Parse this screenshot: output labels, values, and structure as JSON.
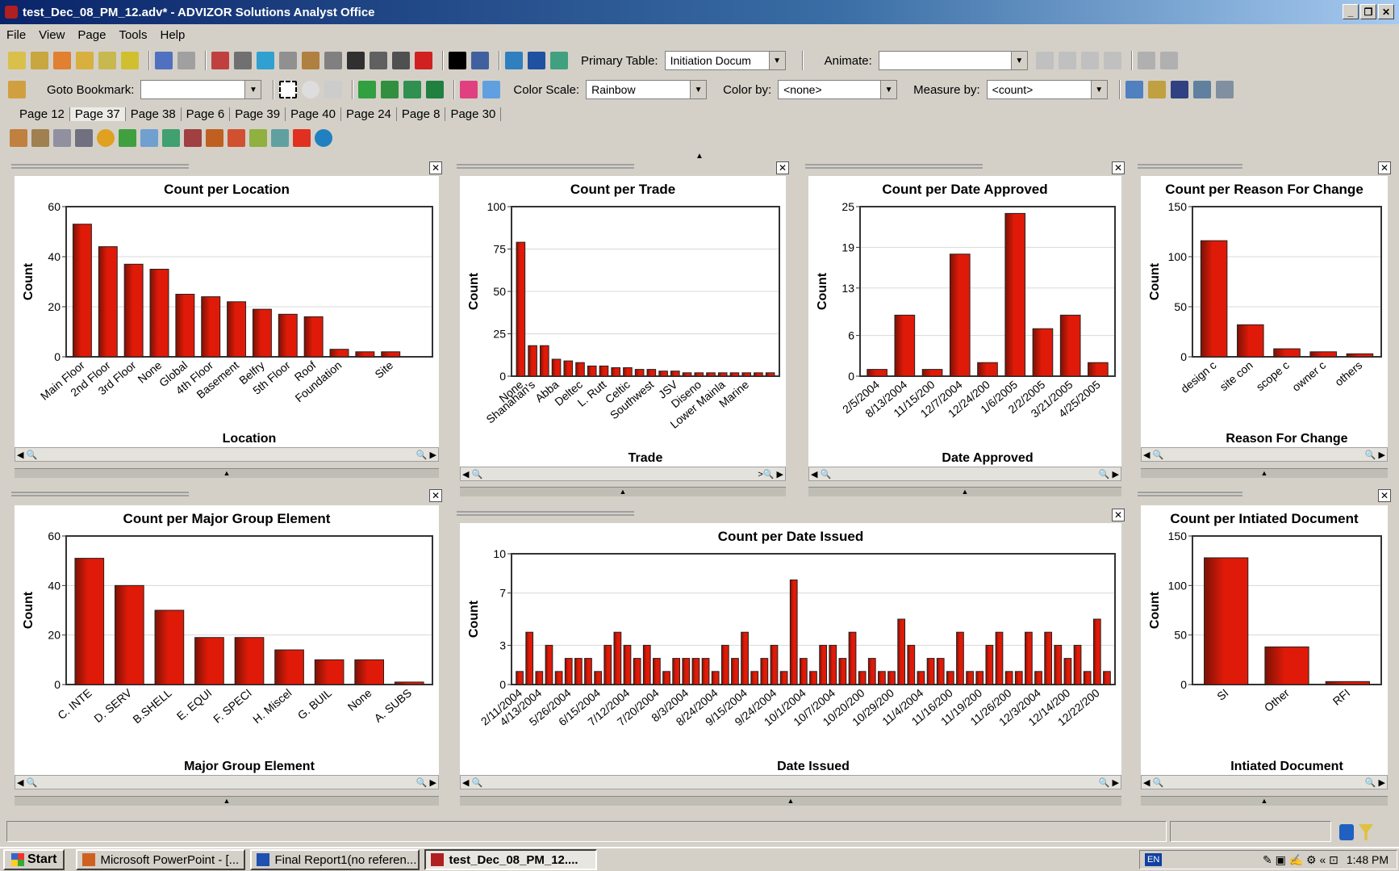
{
  "window": {
    "title": "test_Dec_08_PM_12.adv* - ADVIZOR Solutions Analyst Office"
  },
  "menu": [
    "File",
    "View",
    "Page",
    "Tools",
    "Help"
  ],
  "toolbar": {
    "primary_table_label": "Primary Table:",
    "primary_table_value": "Initiation Docum",
    "animate_label": "Animate:",
    "goto_bookmark_label": "Goto Bookmark:",
    "color_scale_label": "Color Scale:",
    "color_scale_value": "Rainbow",
    "color_by_label": "Color by:",
    "color_by_value": "<none>",
    "measure_by_label": "Measure by:",
    "measure_by_value": "<count>"
  },
  "pages": [
    "Page 12",
    "Page 37",
    "Page 38",
    "Page 6",
    "Page 39",
    "Page 40",
    "Page 24",
    "Page 8",
    "Page 30"
  ],
  "colors": {
    "bar": "#e01a08",
    "bar_dark": "#7a1206"
  },
  "chart_data": [
    {
      "type": "bar",
      "title": "Count per Location",
      "xlabel": "Location",
      "ylabel": "Count",
      "categories": [
        "Main Floor",
        "2nd Floor",
        "3rd Floor",
        "None",
        "Global",
        "4th Floor",
        "Basement",
        "Belfry",
        "5th Floor",
        "Roof",
        "Foundation",
        "",
        "Site",
        ""
      ],
      "values": [
        53,
        44,
        37,
        35,
        25,
        24,
        22,
        19,
        17,
        16,
        3,
        2,
        2,
        0
      ],
      "ylim": [
        0,
        60
      ],
      "yticks": [
        0,
        20,
        40,
        60
      ]
    },
    {
      "type": "bar",
      "title": "Count per Trade",
      "xlabel": "Trade",
      "ylabel": "Count",
      "categories": [
        "None",
        "Shanahan's",
        "",
        "Abba",
        "",
        "Deltec",
        "",
        "L. Rutt",
        "",
        "Celtic",
        "",
        "Southwest",
        "",
        "JSV",
        "",
        "Diseno",
        "",
        "Lower Mainla",
        "",
        "Marine",
        "",
        ""
      ],
      "values": [
        79,
        18,
        18,
        10,
        9,
        8,
        6,
        6,
        5,
        5,
        4,
        4,
        3,
        3,
        2,
        2,
        2,
        2,
        2,
        2,
        2,
        2
      ],
      "ylim": [
        0,
        100
      ],
      "yticks": [
        0,
        25,
        50,
        75,
        100
      ]
    },
    {
      "type": "bar",
      "title": "Count per Date Approved",
      "xlabel": "Date Approved",
      "ylabel": "Count",
      "categories": [
        "2/5/2004",
        "8/13/2004",
        "11/15/200",
        "12/7/2004",
        "12/24/200",
        "1/6/2005",
        "2/2/2005",
        "3/21/2005",
        "4/25/2005"
      ],
      "values": [
        1,
        9,
        1,
        18,
        2,
        24,
        7,
        9,
        2
      ],
      "ylim": [
        0,
        25
      ],
      "yticks": [
        0,
        6,
        13,
        19,
        25
      ]
    },
    {
      "type": "bar",
      "title": "Count per Reason For Change",
      "xlabel": "Reason For Change",
      "ylabel": "Count",
      "categories": [
        "design c",
        "site con",
        "scope c",
        "owner c",
        "others"
      ],
      "values": [
        116,
        32,
        8,
        5,
        3
      ],
      "ylim": [
        0,
        150
      ],
      "yticks": [
        0,
        50,
        100,
        150
      ]
    },
    {
      "type": "bar",
      "title": "Count per Major Group Element",
      "xlabel": "Major Group Element",
      "ylabel": "Count",
      "categories": [
        "C. INTE",
        "D. SERV",
        "B.SHELL",
        "E. EQUI",
        "F. SPECI",
        "H. Miscel",
        "G. BUIL",
        "None",
        "A. SUBS"
      ],
      "values": [
        51,
        40,
        30,
        19,
        19,
        14,
        10,
        10,
        1
      ],
      "ylim": [
        0,
        60
      ],
      "yticks": [
        0,
        20,
        40,
        60
      ]
    },
    {
      "type": "bar",
      "title": "Count per  Date  Issued",
      "xlabel": "Date  Issued",
      "ylabel": "Count",
      "categories": [
        "2/11/2004",
        "",
        "4/13/2004",
        "",
        "",
        "5/26/2004",
        "",
        "",
        "6/15/2004",
        "",
        "",
        "7/12/2004",
        "",
        "",
        "7/20/2004",
        "",
        "",
        "8/3/2004",
        "",
        "",
        "8/24/2004",
        "",
        "",
        "9/15/2004",
        "",
        "",
        "9/24/2004",
        "",
        "",
        "10/1/2004",
        "",
        "",
        "10/7/2004",
        "",
        "",
        "10/20/200",
        "",
        "",
        "10/29/200",
        "",
        "",
        "11/4/2004",
        "",
        "",
        "11/16/200",
        "",
        "",
        "11/19/200",
        "",
        "",
        "11/26/200",
        "",
        "",
        "12/3/2004",
        "",
        "",
        "12/14/200",
        "",
        "",
        "12/22/200",
        "",
        ""
      ],
      "values": [
        1,
        4,
        1,
        3,
        1,
        2,
        2,
        2,
        1,
        3,
        4,
        3,
        2,
        3,
        2,
        1,
        2,
        2,
        2,
        2,
        1,
        3,
        2,
        4,
        1,
        2,
        3,
        1,
        8,
        2,
        1,
        3,
        3,
        2,
        4,
        1,
        2,
        1,
        1,
        5,
        3,
        1,
        2,
        2,
        1,
        4,
        1,
        1,
        3,
        4,
        1,
        1,
        4,
        1,
        4,
        3,
        2,
        3,
        1,
        5,
        1
      ],
      "ylim": [
        0,
        10
      ],
      "yticks": [
        0,
        3,
        7,
        10
      ]
    },
    {
      "type": "bar",
      "title": "Count per Intiated Document",
      "xlabel": "Intiated Document",
      "ylabel": "Count",
      "categories": [
        "SI",
        "Other",
        "RFI"
      ],
      "values": [
        128,
        38,
        3
      ],
      "ylim": [
        0,
        150
      ],
      "yticks": [
        0,
        50,
        100,
        150
      ]
    }
  ],
  "taskbar": {
    "start": "Start",
    "items": [
      "Microsoft PowerPoint - [...",
      "Final Report1(no referen...",
      "test_Dec_08_PM_12...."
    ],
    "lang": "EN",
    "clock": "1:48 PM"
  }
}
